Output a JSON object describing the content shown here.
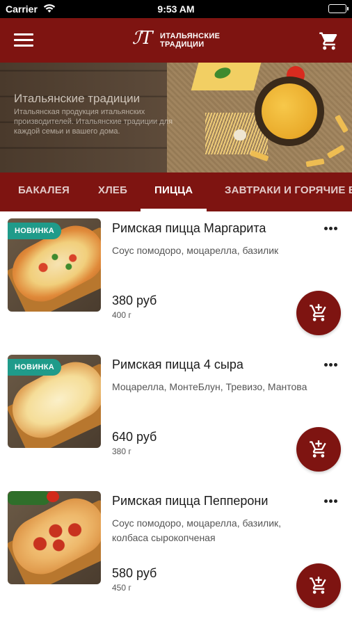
{
  "status_bar": {
    "carrier": "Carrier",
    "time": "9:53 AM"
  },
  "header": {
    "logo_text_line1": "ИТАЛЬЯНСКИЕ",
    "logo_text_line2": "ТРАДИЦИИ",
    "logo_mark": "ℐT",
    "accent_color": "#7e1411"
  },
  "hero": {
    "title": "Итальянские традиции",
    "text": "Итальянская продукция итальянских производителей. Итальянские традиции для каждой семьи и вашего дома."
  },
  "tabs": [
    {
      "label": "БАКАЛЕЯ",
      "active": false
    },
    {
      "label": "ХЛЕБ",
      "active": false
    },
    {
      "label": "ПИЦЦА",
      "active": true
    },
    {
      "label": "ЗАВТРАКИ И ГОРЯЧИЕ БЛЮДА",
      "active": false
    }
  ],
  "products": [
    {
      "badge": "НОВИНКА",
      "name": "Римская пицца Маргарита",
      "description": "Соус помодоро, моцарелла, базилик",
      "price": "380 руб",
      "weight": "400 г"
    },
    {
      "badge": "НОВИНКА",
      "name": "Римская пицца 4 сыра",
      "description": "Моцарелла, МонтеБлун, Тревизо, Мантова",
      "price": "640 руб",
      "weight": "380 г"
    },
    {
      "badge": "",
      "name": "Римская пицца Пепперони",
      "description": "Соус помодоро, моцарелла, базилик, колбаса сырокопченая",
      "price": "580 руб",
      "weight": "450 г"
    }
  ],
  "icons": {
    "menu": "hamburger-icon",
    "cart": "cart-icon",
    "add_to_cart": "add-to-cart-icon",
    "more": "more-horizontal-icon"
  }
}
